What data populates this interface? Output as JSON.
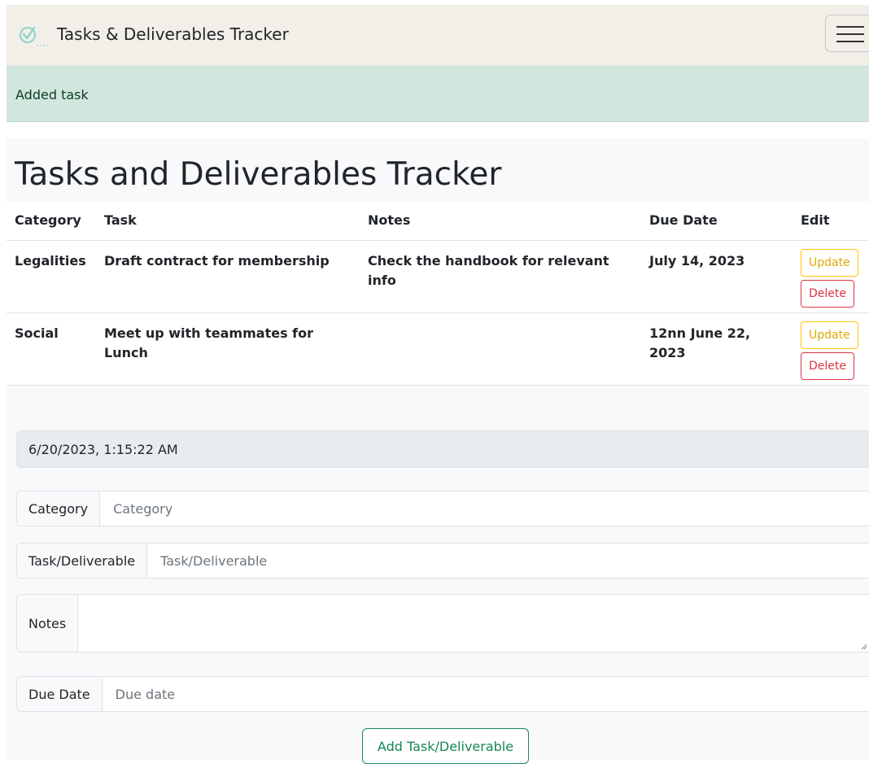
{
  "navbar": {
    "brand": "Tasks & Deliverables Tracker",
    "brand_icon": "check-circle-icon",
    "menu_icon": "hamburger-menu-icon"
  },
  "alert": {
    "message": "Added task"
  },
  "page": {
    "title": "Tasks and Deliverables Tracker"
  },
  "table": {
    "headers": [
      "Category",
      "Task",
      "Notes",
      "Due Date",
      "Edit"
    ],
    "rows": [
      {
        "category": "Legalities",
        "task": "Draft contract for membership",
        "notes": "Check the handbook for relevant info",
        "due_date": "July 14, 2023"
      },
      {
        "category": "Social",
        "task": "Meet up with teammates for Lunch",
        "notes": "",
        "due_date": "12nn June 22, 2023"
      }
    ],
    "update_label": "Update",
    "delete_label": "Delete"
  },
  "clock": {
    "datetime": "6/20/2023, 1:15:22 AM"
  },
  "form": {
    "category_label": "Category",
    "category_placeholder": "Category",
    "task_label": "Task/Deliverable",
    "task_placeholder": "Task/Deliverable",
    "notes_label": "Notes",
    "due_label": "Due Date",
    "due_placeholder": "Due date",
    "submit_label": "Add Task/Deliverable"
  },
  "colors": {
    "navbar_bg": "#f2efe9",
    "alert_bg": "#d1e7dd",
    "update": "#ffc107",
    "delete": "#dc3545",
    "success": "#198754"
  }
}
